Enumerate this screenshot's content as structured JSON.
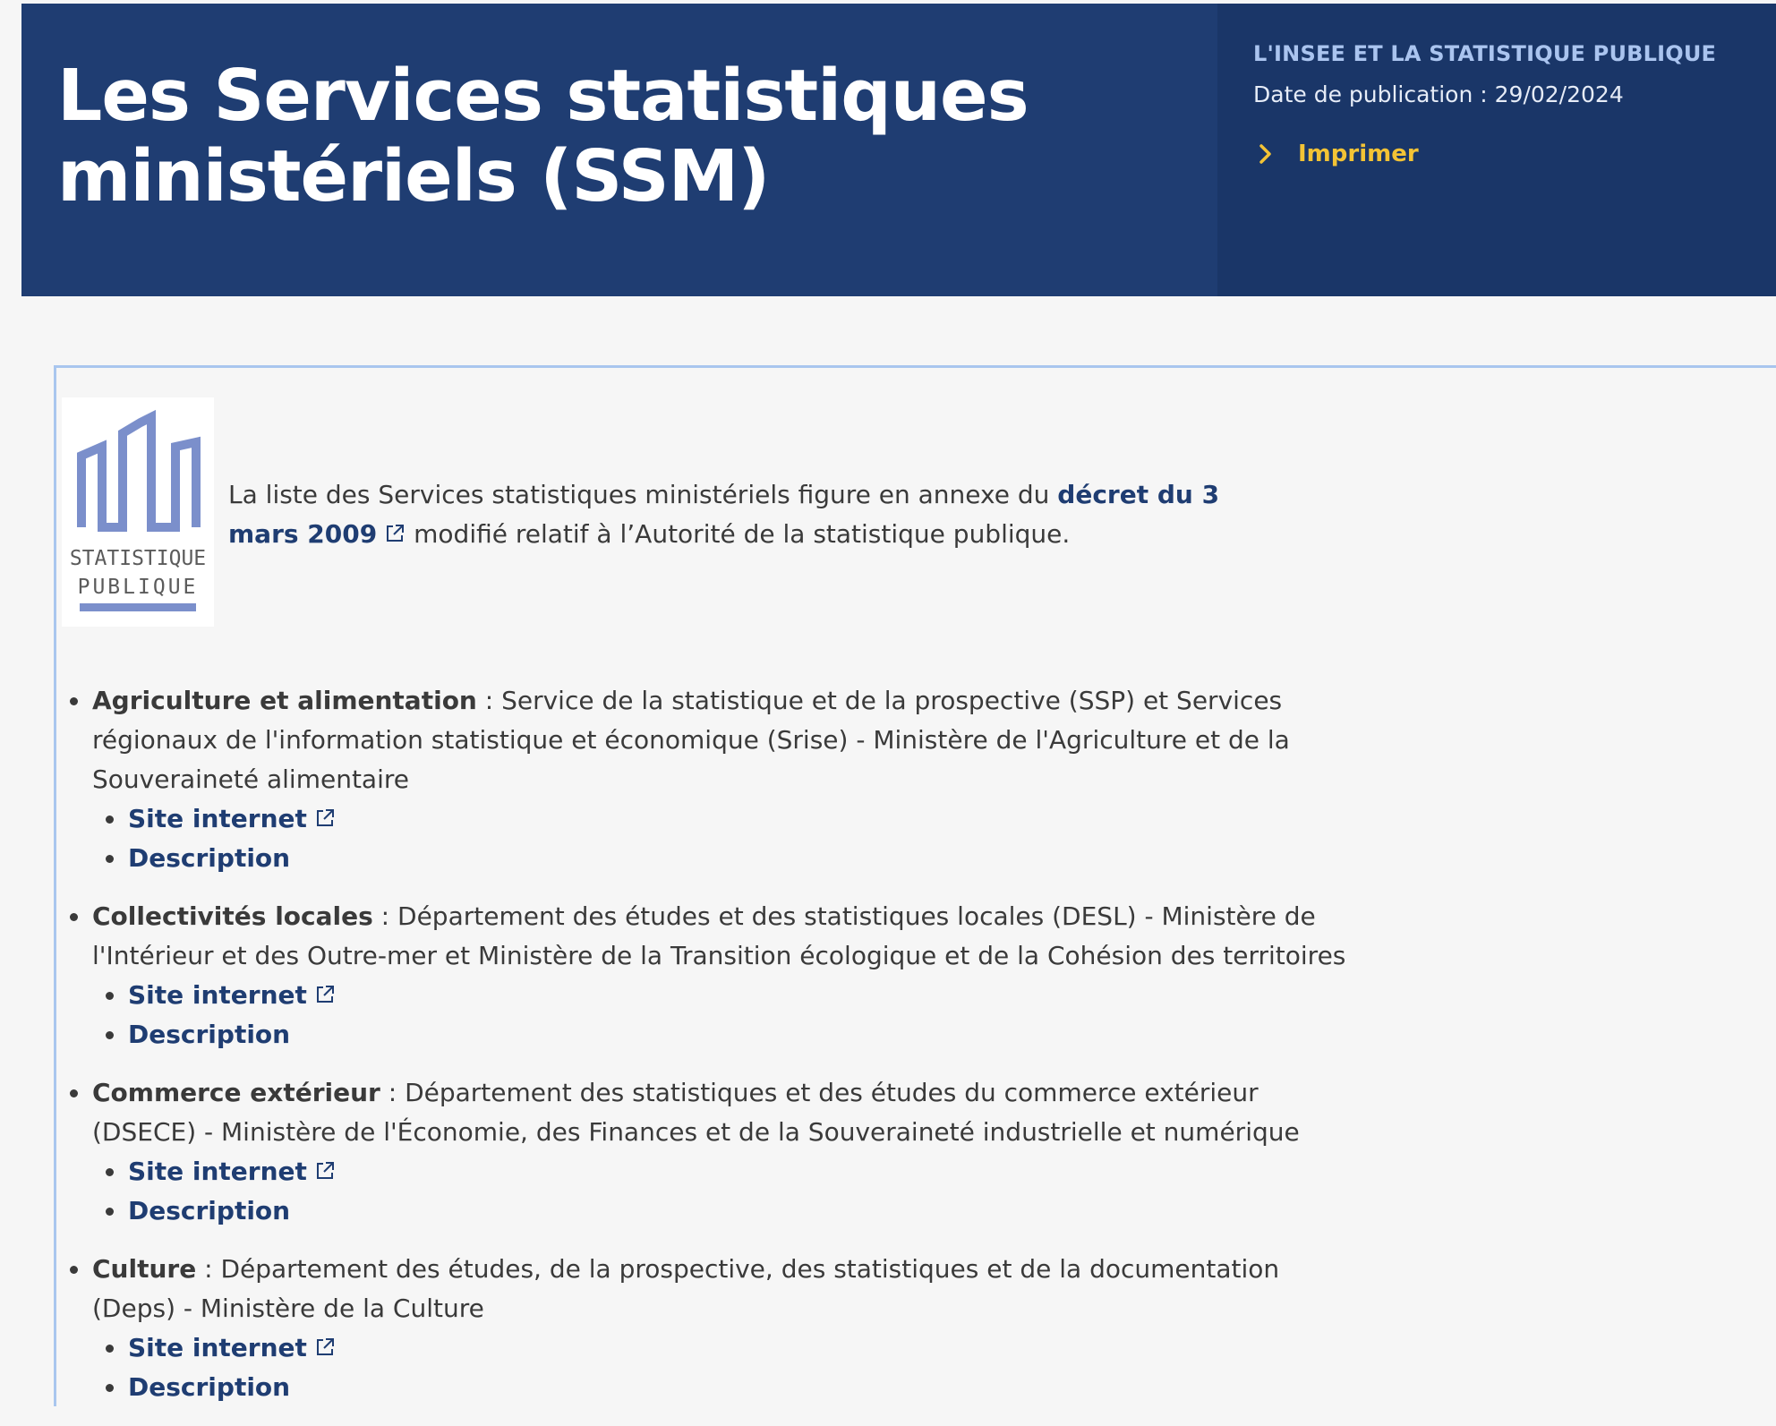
{
  "header": {
    "title": "Les Services statistiques ministériels (SSM)",
    "category": "L'INSEE ET LA STATISTIQUE PUBLIQUE",
    "publication_date": "Date de publication : 29/02/2024",
    "print_label": "Imprimer"
  },
  "logo": {
    "line1": "STATISTIQUE",
    "line2": "PUBLIQUE",
    "color": "#7b8fcb"
  },
  "intro": {
    "text_before": "La liste des Services statistiques ministériels figure en annexe du ",
    "link_text": "décret du 3 mars 2009",
    "text_after": " modifié relatif à l’Autorité de la statistique publique."
  },
  "services": [
    {
      "name": "Agriculture et alimentation",
      "description": " : Service de la statistique et de la prospective (SSP) et Services régionaux de l'information statistique et économique (Srise) - Ministère de l'Agriculture et de la Souveraineté alimentaire",
      "site_label": "Site internet",
      "desc_label": "Description"
    },
    {
      "name": "Collectivités locales",
      "description": " : Département des études et des statistiques locales (DESL) - Ministère de l'Intérieur et des Outre-mer et Ministère de la Transition écologique et de la Cohésion des territoires",
      "site_label": "Site internet",
      "desc_label": "Description"
    },
    {
      "name": "Commerce extérieur",
      "description": " : Département des statistiques et des études du commerce extérieur (DSECE) - Ministère de l'Économie, des Finances et de la Souveraineté industrielle et numérique",
      "site_label": "Site internet",
      "desc_label": "Description"
    },
    {
      "name": "Culture",
      "description": " : Département des études, de la prospective, des statistiques et de la documentation (Deps) - Ministère de la Culture",
      "site_label": "Site internet",
      "desc_label": "Description"
    }
  ],
  "colors": {
    "banner": "#1f3d72",
    "banner_right": "#1a3668",
    "accent_yellow": "#f3c335",
    "link": "#1f3d72",
    "box_border": "#a9c6ee"
  }
}
